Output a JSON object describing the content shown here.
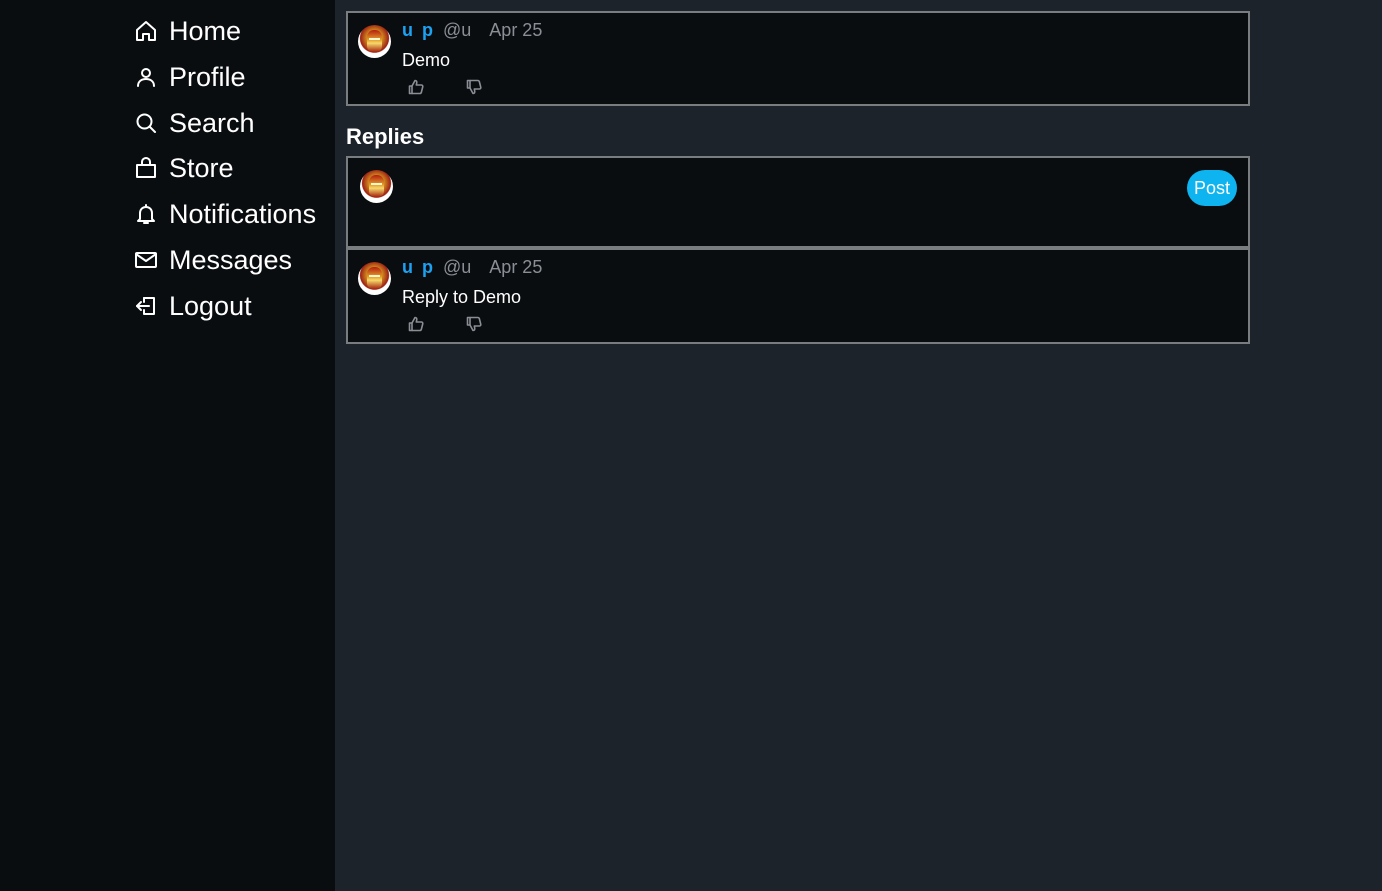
{
  "sidebar": {
    "items": [
      {
        "label": "Home",
        "icon": "home-icon"
      },
      {
        "label": "Profile",
        "icon": "user-icon"
      },
      {
        "label": "Search",
        "icon": "search-icon"
      },
      {
        "label": "Store",
        "icon": "shopping-bag-icon"
      },
      {
        "label": "Notifications",
        "icon": "bell-icon"
      },
      {
        "label": "Messages",
        "icon": "mail-icon"
      },
      {
        "label": "Logout",
        "icon": "logout-icon"
      }
    ]
  },
  "post": {
    "author": "u p",
    "handle": "@u",
    "date": "Apr 25",
    "text": "Demo"
  },
  "replies": {
    "title": "Replies",
    "composer": {
      "placeholder": "",
      "post_label": "Post"
    },
    "items": [
      {
        "author": "u p",
        "handle": "@u",
        "date": "Apr 25",
        "text": "Reply to Demo"
      }
    ]
  },
  "colors": {
    "sidebar_bg": "#0a0d10",
    "main_bg": "#1d232b",
    "accent": "#1da1f2",
    "post_button": "#0eb4f0",
    "card_border": "#7a7d80"
  }
}
